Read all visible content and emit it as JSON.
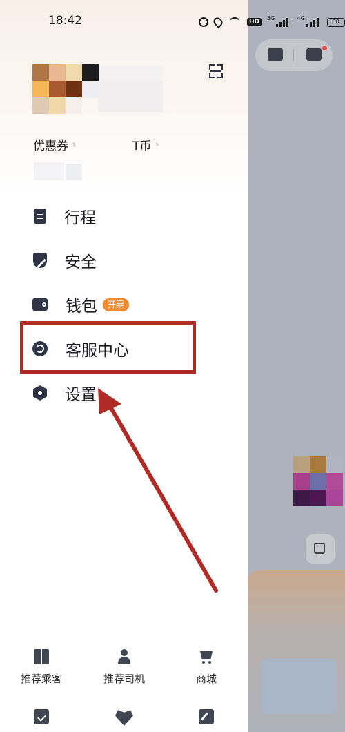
{
  "status_bar": {
    "time": "18:42",
    "hd_label": "HD",
    "signal1_label": "5G",
    "signal2_label": "4G",
    "battery": "60"
  },
  "header": {
    "coupons_label": "优惠券",
    "tcoins_label": "T币"
  },
  "menu": {
    "items": [
      {
        "label": "行程",
        "icon": "trip-list-icon"
      },
      {
        "label": "安全",
        "icon": "shield-icon"
      },
      {
        "label": "钱包",
        "icon": "wallet-icon",
        "badge": "开票"
      },
      {
        "label": "客服中心",
        "icon": "customer-service-icon"
      },
      {
        "label": "设置",
        "icon": "settings-icon"
      }
    ]
  },
  "bottom_nav": {
    "row1": [
      {
        "label": "推荐乘客",
        "icon": "gift-icon"
      },
      {
        "label": "推荐司机",
        "icon": "driver-icon"
      },
      {
        "label": "商城",
        "icon": "cart-icon"
      }
    ],
    "row2": [
      {
        "icon": "calendar-check-icon"
      },
      {
        "icon": "heart-icon"
      },
      {
        "icon": "edit-icon"
      }
    ]
  },
  "colors": {
    "highlight": "#b12b26",
    "badge": "#f28a2f",
    "icon": "#2f3446"
  }
}
